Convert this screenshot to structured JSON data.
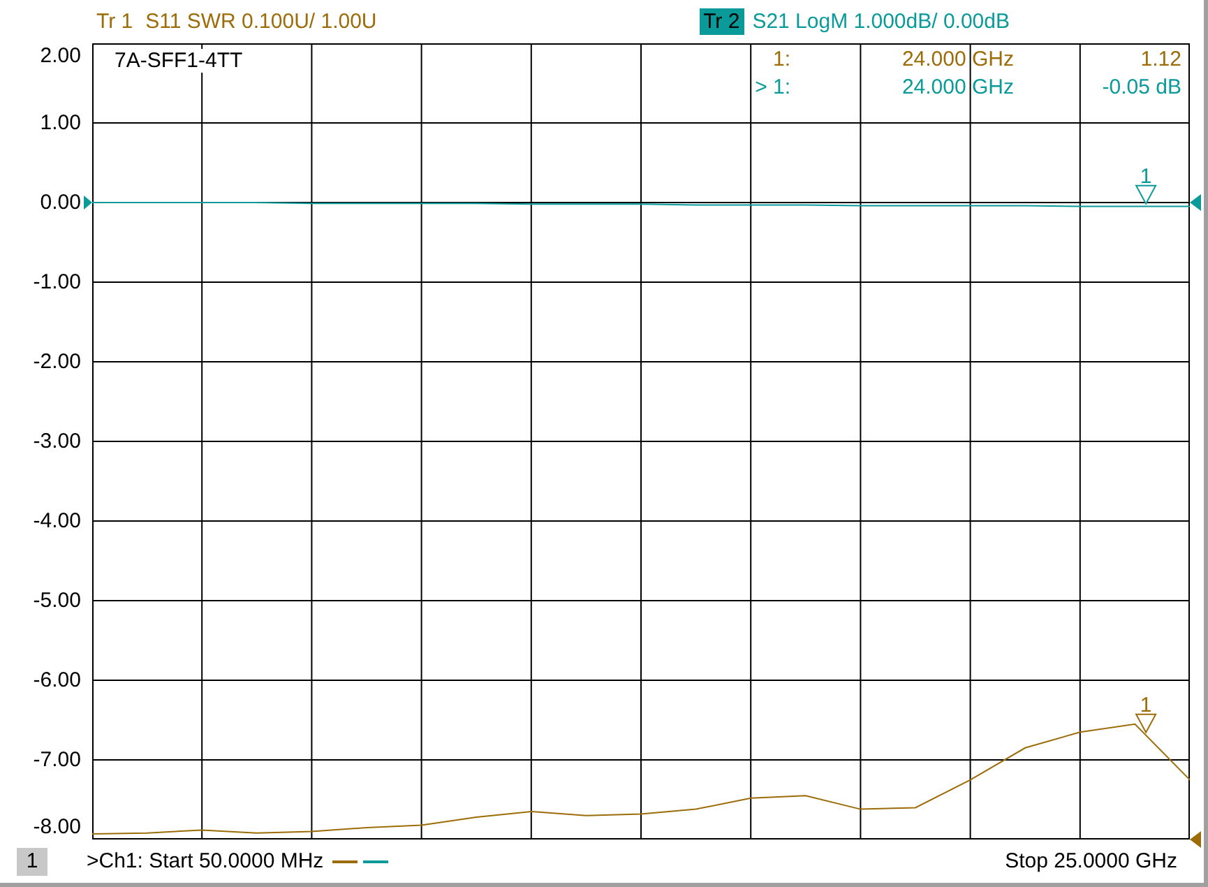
{
  "traces": [
    {
      "description": "S11 SWR 0.100U/  1.00U",
      "color": "#9c6c08",
      "selected": false
    },
    {
      "description": "S21 LogM 1.000dB/  0.00dB",
      "color": "#0a9a9a",
      "selected": true
    }
  ],
  "plot": {
    "title": "7A-SFF1-4TT",
    "readouts": [
      {
        "marker": "1:",
        "frequency": "24.000 GHz",
        "value": "1.12",
        "color": "#9c6c08"
      },
      {
        "marker": "> 1:",
        "frequency": "24.000 GHz",
        "value": "-0.05 dB",
        "color": "#0a9a9a"
      }
    ],
    "markers": [
      {
        "label": "1"
      },
      {
        "label": "1"
      }
    ],
    "chart_data": {
      "type": "line",
      "categories": [
        null,
        null,
        null,
        null,
        null,
        null,
        null,
        null,
        null,
        null,
        null,
        null,
        null,
        null,
        null,
        null,
        null,
        null,
        null,
        null,
        null
      ],
      "ylim": [
        -8,
        2
      ],
      "grid": true,
      "yticks": [
        {
          "value": 2,
          "label": "2.00"
        },
        {
          "value": 1,
          "label": "1.00"
        },
        {
          "value": 0,
          "label": "0.00"
        },
        {
          "value": -1,
          "label": "-1.00"
        },
        {
          "value": -2,
          "label": "-2.00"
        },
        {
          "value": -3,
          "label": "-3.00"
        },
        {
          "value": -4,
          "label": "-4.00"
        },
        {
          "value": -5,
          "label": "-5.00"
        },
        {
          "value": -6,
          "label": "-6.00"
        },
        {
          "value": -7,
          "label": "-7.00"
        },
        {
          "value": -8,
          "label": "-8.00"
        }
      ],
      "series": [
        {
          "name": "Tr 1",
          "color": "#9c6c08",
          "values": [
            -7.93,
            -7.92,
            -7.88,
            -7.92,
            -7.9,
            -7.85,
            -7.82,
            -7.72,
            -7.65,
            -7.7,
            -7.68,
            -7.62,
            -7.48,
            -7.45,
            -7.62,
            -7.6,
            -7.25,
            -6.85,
            -6.65,
            -6.55,
            -7.25
          ]
        },
        {
          "name": "Tr 2",
          "color": "#0a9a9a",
          "values": [
            0.0,
            0.0,
            0.0,
            0.0,
            -0.01,
            -0.01,
            -0.01,
            -0.01,
            -0.02,
            -0.02,
            -0.02,
            -0.03,
            -0.03,
            -0.03,
            -0.04,
            -0.04,
            -0.04,
            -0.04,
            -0.05,
            -0.05,
            -0.05
          ]
        }
      ]
    }
  },
  "status_bar": {
    "channel": "1",
    "start": ">Ch1: Start  50.0000 MHz",
    "stop": "Stop  25.0000 GHz"
  }
}
